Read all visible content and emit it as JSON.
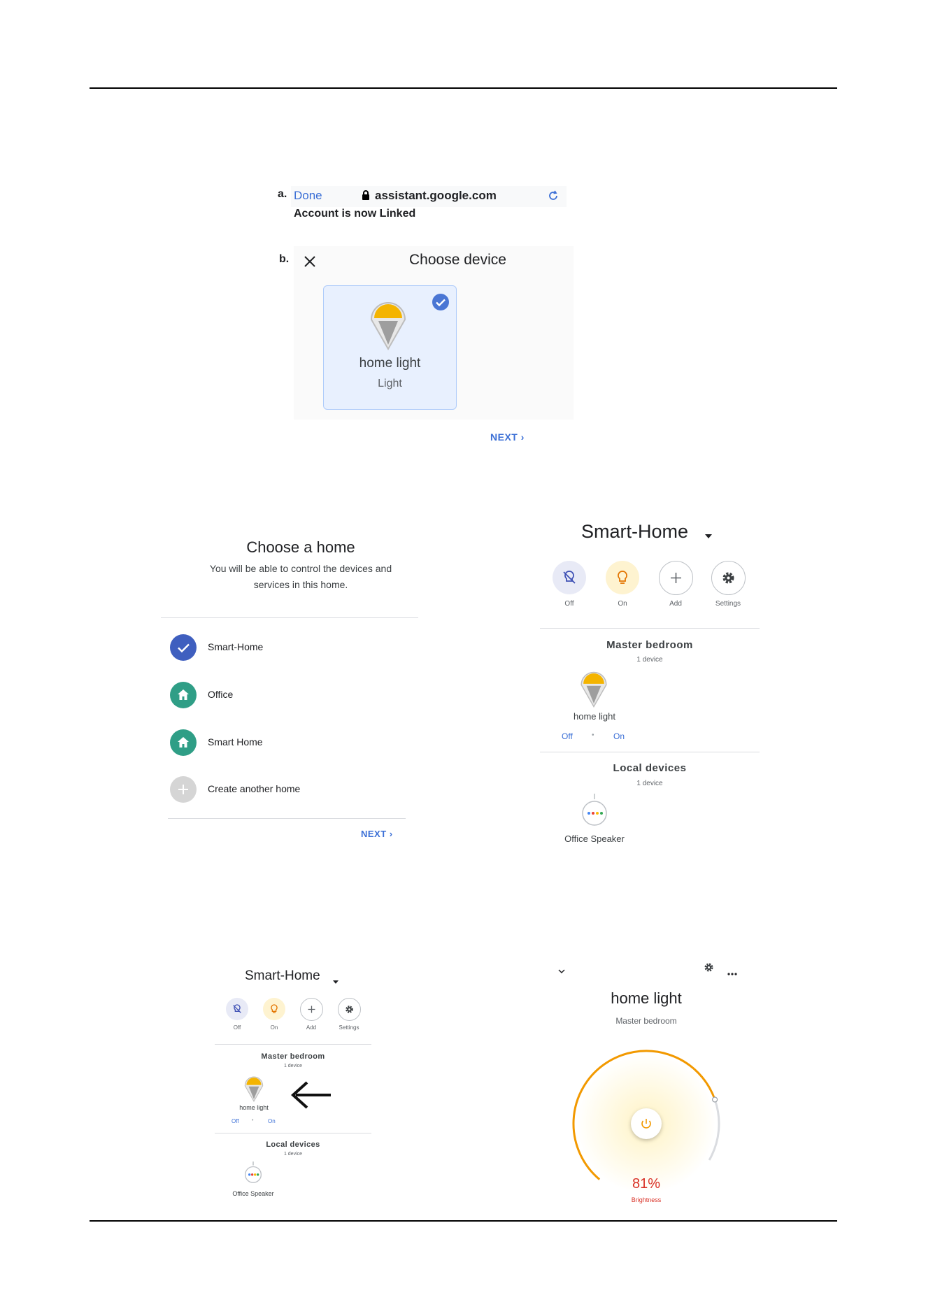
{
  "step_a": {
    "label": "a.",
    "done": "Done",
    "url": "assistant.google.com",
    "linked": "Account is now Linked"
  },
  "step_b": {
    "label": "b.",
    "title": "Choose device",
    "device_name": "home light",
    "device_type": "Light",
    "next": "NEXT"
  },
  "choose_home": {
    "title": "Choose a home",
    "subtitle_line1": "You will be able to control the devices and",
    "subtitle_line2": "services in this home.",
    "homes": [
      "Smart-Home",
      "Office",
      "Smart Home",
      "Create another home"
    ],
    "next": "NEXT"
  },
  "smart_home_large": {
    "title": "Smart-Home",
    "actions": [
      "Off",
      "On",
      "Add",
      "Settings"
    ],
    "room1": {
      "name": "Master bedroom",
      "count": "1 device",
      "device": "home light",
      "off": "Off",
      "on": "On"
    },
    "room2": {
      "name": "Local devices",
      "count": "1 device",
      "device": "Office Speaker"
    }
  },
  "smart_home_small": {
    "title": "Smart-Home",
    "actions": [
      "Off",
      "On",
      "Add",
      "Settings"
    ],
    "room1": {
      "name": "Master bedroom",
      "count": "1 device",
      "device": "home light",
      "off": "Off",
      "on": "On"
    },
    "room2": {
      "name": "Local devices",
      "count": "1 device",
      "device": "Office Speaker"
    }
  },
  "light_detail": {
    "title": "home light",
    "room": "Master bedroom",
    "brightness_value": "81%",
    "brightness_label": "Brightness",
    "brightness_level": 0.81
  },
  "colors": {
    "accent_blue": "#3b6fd6",
    "bulb_yellow": "#f4b400",
    "teal_home": "#2f9e86",
    "arc_orange": "#f29900",
    "brightness_red": "#d93025"
  }
}
